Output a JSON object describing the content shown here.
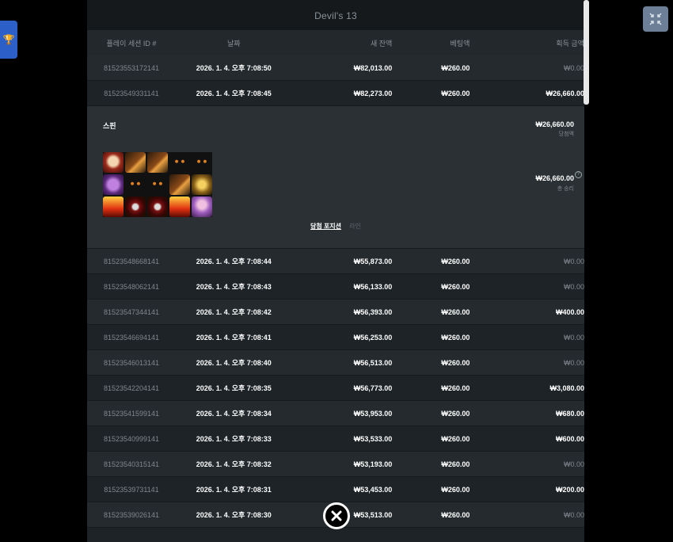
{
  "game_title": "Devil's 13",
  "columns": {
    "session_id": "플레이 세션 ID #",
    "date": "날짜",
    "balance": "새 잔액",
    "bet": "베팅액",
    "win": "획득 금액"
  },
  "rows_top": [
    {
      "id": "81523553172141",
      "date": "2026. 1. 4. 오후 7:08:50",
      "balance": "₩82,013.00",
      "bet": "₩260.00",
      "win": "₩0.00",
      "win_zero": true
    },
    {
      "id": "81523549331141",
      "date": "2026. 1. 4. 오후 7:08:45",
      "balance": "₩82,273.00",
      "bet": "₩260.00",
      "win": "₩26,660.00",
      "win_zero": false
    }
  ],
  "detail": {
    "spin_label": "스핀",
    "win_amount": "₩26,660.00",
    "win_amount_sub": "당첨액",
    "total_amount": "₩26,660.00",
    "total_amount_sub": "총 승리",
    "help_glyph": "?",
    "tab_active": "당첨 포지션",
    "tab_other": "라인",
    "grid": [
      [
        "skull",
        "bell",
        "bell",
        "cat",
        "cat"
      ],
      [
        "purple",
        "cat",
        "cat",
        "bell",
        "gold"
      ],
      [
        "fire",
        "ring",
        "ring",
        "fire",
        "girl"
      ]
    ]
  },
  "rows_bottom": [
    {
      "id": "81523548668141",
      "date": "2026. 1. 4. 오후 7:08:44",
      "balance": "₩55,873.00",
      "bet": "₩260.00",
      "win": "₩0.00",
      "win_zero": true
    },
    {
      "id": "81523548062141",
      "date": "2026. 1. 4. 오후 7:08:43",
      "balance": "₩56,133.00",
      "bet": "₩260.00",
      "win": "₩0.00",
      "win_zero": true
    },
    {
      "id": "81523547344141",
      "date": "2026. 1. 4. 오후 7:08:42",
      "balance": "₩56,393.00",
      "bet": "₩260.00",
      "win": "₩400.00",
      "win_zero": false
    },
    {
      "id": "81523546694141",
      "date": "2026. 1. 4. 오후 7:08:41",
      "balance": "₩56,253.00",
      "bet": "₩260.00",
      "win": "₩0.00",
      "win_zero": true
    },
    {
      "id": "81523546013141",
      "date": "2026. 1. 4. 오후 7:08:40",
      "balance": "₩56,513.00",
      "bet": "₩260.00",
      "win": "₩0.00",
      "win_zero": true
    },
    {
      "id": "81523542204141",
      "date": "2026. 1. 4. 오후 7:08:35",
      "balance": "₩56,773.00",
      "bet": "₩260.00",
      "win": "₩3,080.00",
      "win_zero": false
    },
    {
      "id": "81523541599141",
      "date": "2026. 1. 4. 오후 7:08:34",
      "balance": "₩53,953.00",
      "bet": "₩260.00",
      "win": "₩680.00",
      "win_zero": false
    },
    {
      "id": "81523540999141",
      "date": "2026. 1. 4. 오후 7:08:33",
      "balance": "₩53,533.00",
      "bet": "₩260.00",
      "win": "₩600.00",
      "win_zero": false
    },
    {
      "id": "81523540315141",
      "date": "2026. 1. 4. 오후 7:08:32",
      "balance": "₩53,193.00",
      "bet": "₩260.00",
      "win": "₩0.00",
      "win_zero": true
    },
    {
      "id": "81523539731141",
      "date": "2026. 1. 4. 오후 7:08:31",
      "balance": "₩53,453.00",
      "bet": "₩260.00",
      "win": "₩200.00",
      "win_zero": false
    },
    {
      "id": "81523539026141",
      "date": "2026. 1. 4. 오후 7:08:30",
      "balance": "₩53,513.00",
      "bet": "₩260.00",
      "win": "₩0.00",
      "win_zero": true
    }
  ],
  "icons": {
    "trophy": "trophy-icon",
    "expand": "collapse-fullscreen-icon",
    "close": "close-icon"
  },
  "colors": {
    "accent_blue": "#2d5fc8",
    "expand_bg": "#6d7f96"
  }
}
